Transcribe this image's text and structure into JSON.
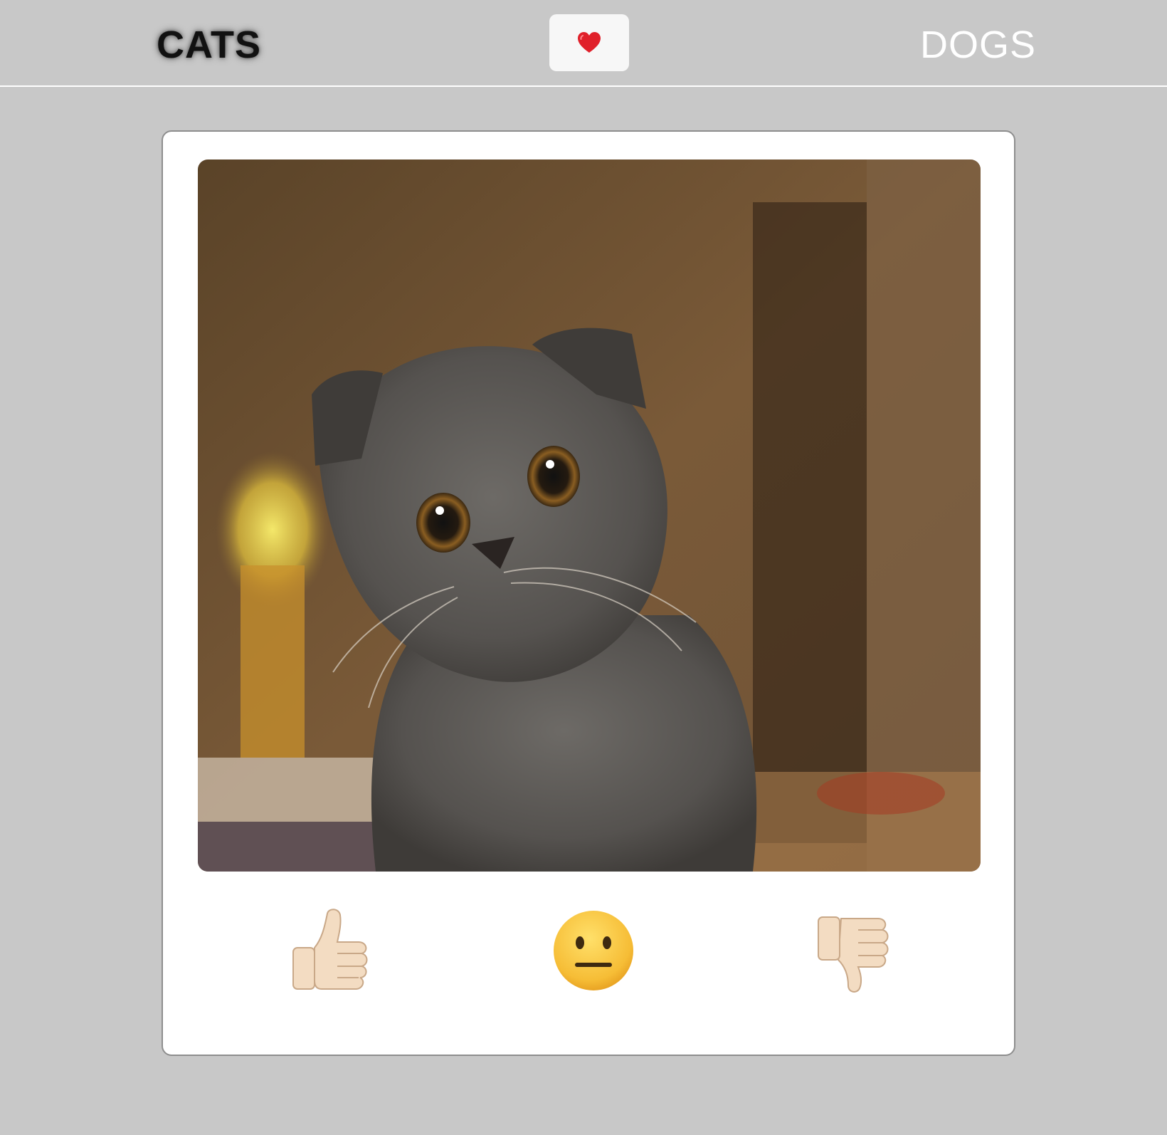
{
  "nav": {
    "left_tab": "CATS",
    "right_tab": "DOGS",
    "center_icon": "heart-icon"
  },
  "photo": {
    "subject": "cat-photo"
  },
  "reactions": [
    {
      "icon": "thumbs-up-icon"
    },
    {
      "icon": "neutral-face-icon"
    },
    {
      "icon": "thumbs-down-icon"
    }
  ],
  "colors": {
    "background": "#c8c8c8",
    "card": "#ffffff",
    "heart": "#e0202a",
    "active_tab": "#111111",
    "inactive_tab": "#ffffff"
  }
}
